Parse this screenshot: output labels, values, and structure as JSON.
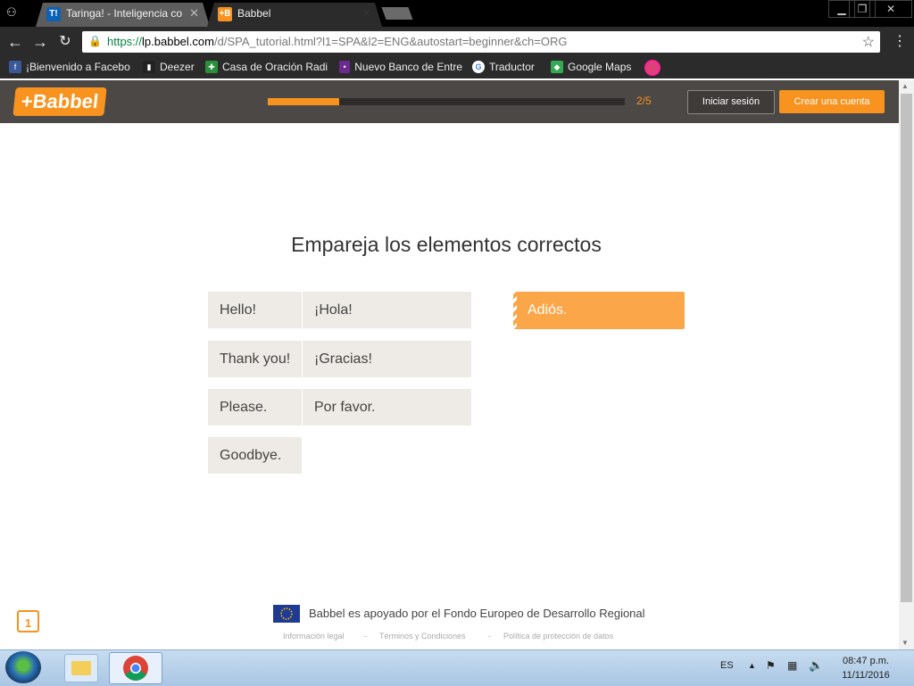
{
  "browser": {
    "tabs": [
      {
        "label": "Taringa! - Inteligencia co",
        "favicon": "T!",
        "favicon_color": "#0b62b6",
        "active": false
      },
      {
        "label": "Babbel",
        "favicon": "+B",
        "favicon_color": "#f7931e",
        "active": true
      }
    ],
    "url_protocol": "https://",
    "url_host": "lp.babbel.com",
    "url_path": "/d/SPA_tutorial.html?l1=SPA&l2=ENG&autostart=beginner&ch=ORG",
    "bookmarks": [
      {
        "label": "¡Bienvenido a Facebo",
        "icon": "facebook-icon",
        "color": "#3b5998",
        "glyph": "f"
      },
      {
        "label": "Deezer",
        "icon": "deezer-icon",
        "color": "#222",
        "glyph": "▮"
      },
      {
        "label": "Casa de Oración Radi",
        "icon": "radio-icon",
        "color": "#2a8f3a",
        "glyph": "✚"
      },
      {
        "label": "Nuevo Banco de Entre",
        "icon": "bank-icon",
        "color": "#6b2a8f",
        "glyph": "•"
      },
      {
        "label": "Traductor",
        "icon": "google-icon",
        "color": "#fff",
        "glyph": "G"
      },
      {
        "label": "Google Maps",
        "icon": "maps-icon",
        "color": "#34a853",
        "glyph": "◆"
      }
    ]
  },
  "babbel": {
    "logo": "+Babbel",
    "progress": {
      "current": 1,
      "total": 5,
      "fraction": 0.2,
      "label": "2/5"
    },
    "login_label": "Iniciar sesión",
    "signup_label": "Crear una cuenta",
    "instruction": "Empareja los elementos correctos",
    "pairs": [
      {
        "left": "Hello!",
        "right": "¡Hola!"
      },
      {
        "left": "Thank you!",
        "right": "¡Gracias!"
      },
      {
        "left": "Please.",
        "right": "Por favor."
      },
      {
        "left": "Goodbye.",
        "right": ""
      }
    ],
    "answer_option": "Adiós.",
    "footer": {
      "badge": "1",
      "eu_text": "Babbel es apoyado por el Fondo Europeo de Desarrollo Regional",
      "links": [
        "Información legal",
        "Términos y Condiciones",
        "Política de protección de datos"
      ],
      "separator": "-"
    }
  },
  "taskbar": {
    "language": "ES",
    "time": "08:47 p.m.",
    "date": "11/11/2016"
  },
  "colors": {
    "accent": "#f7931e",
    "answer": "#fba649",
    "header": "#4b4845"
  }
}
